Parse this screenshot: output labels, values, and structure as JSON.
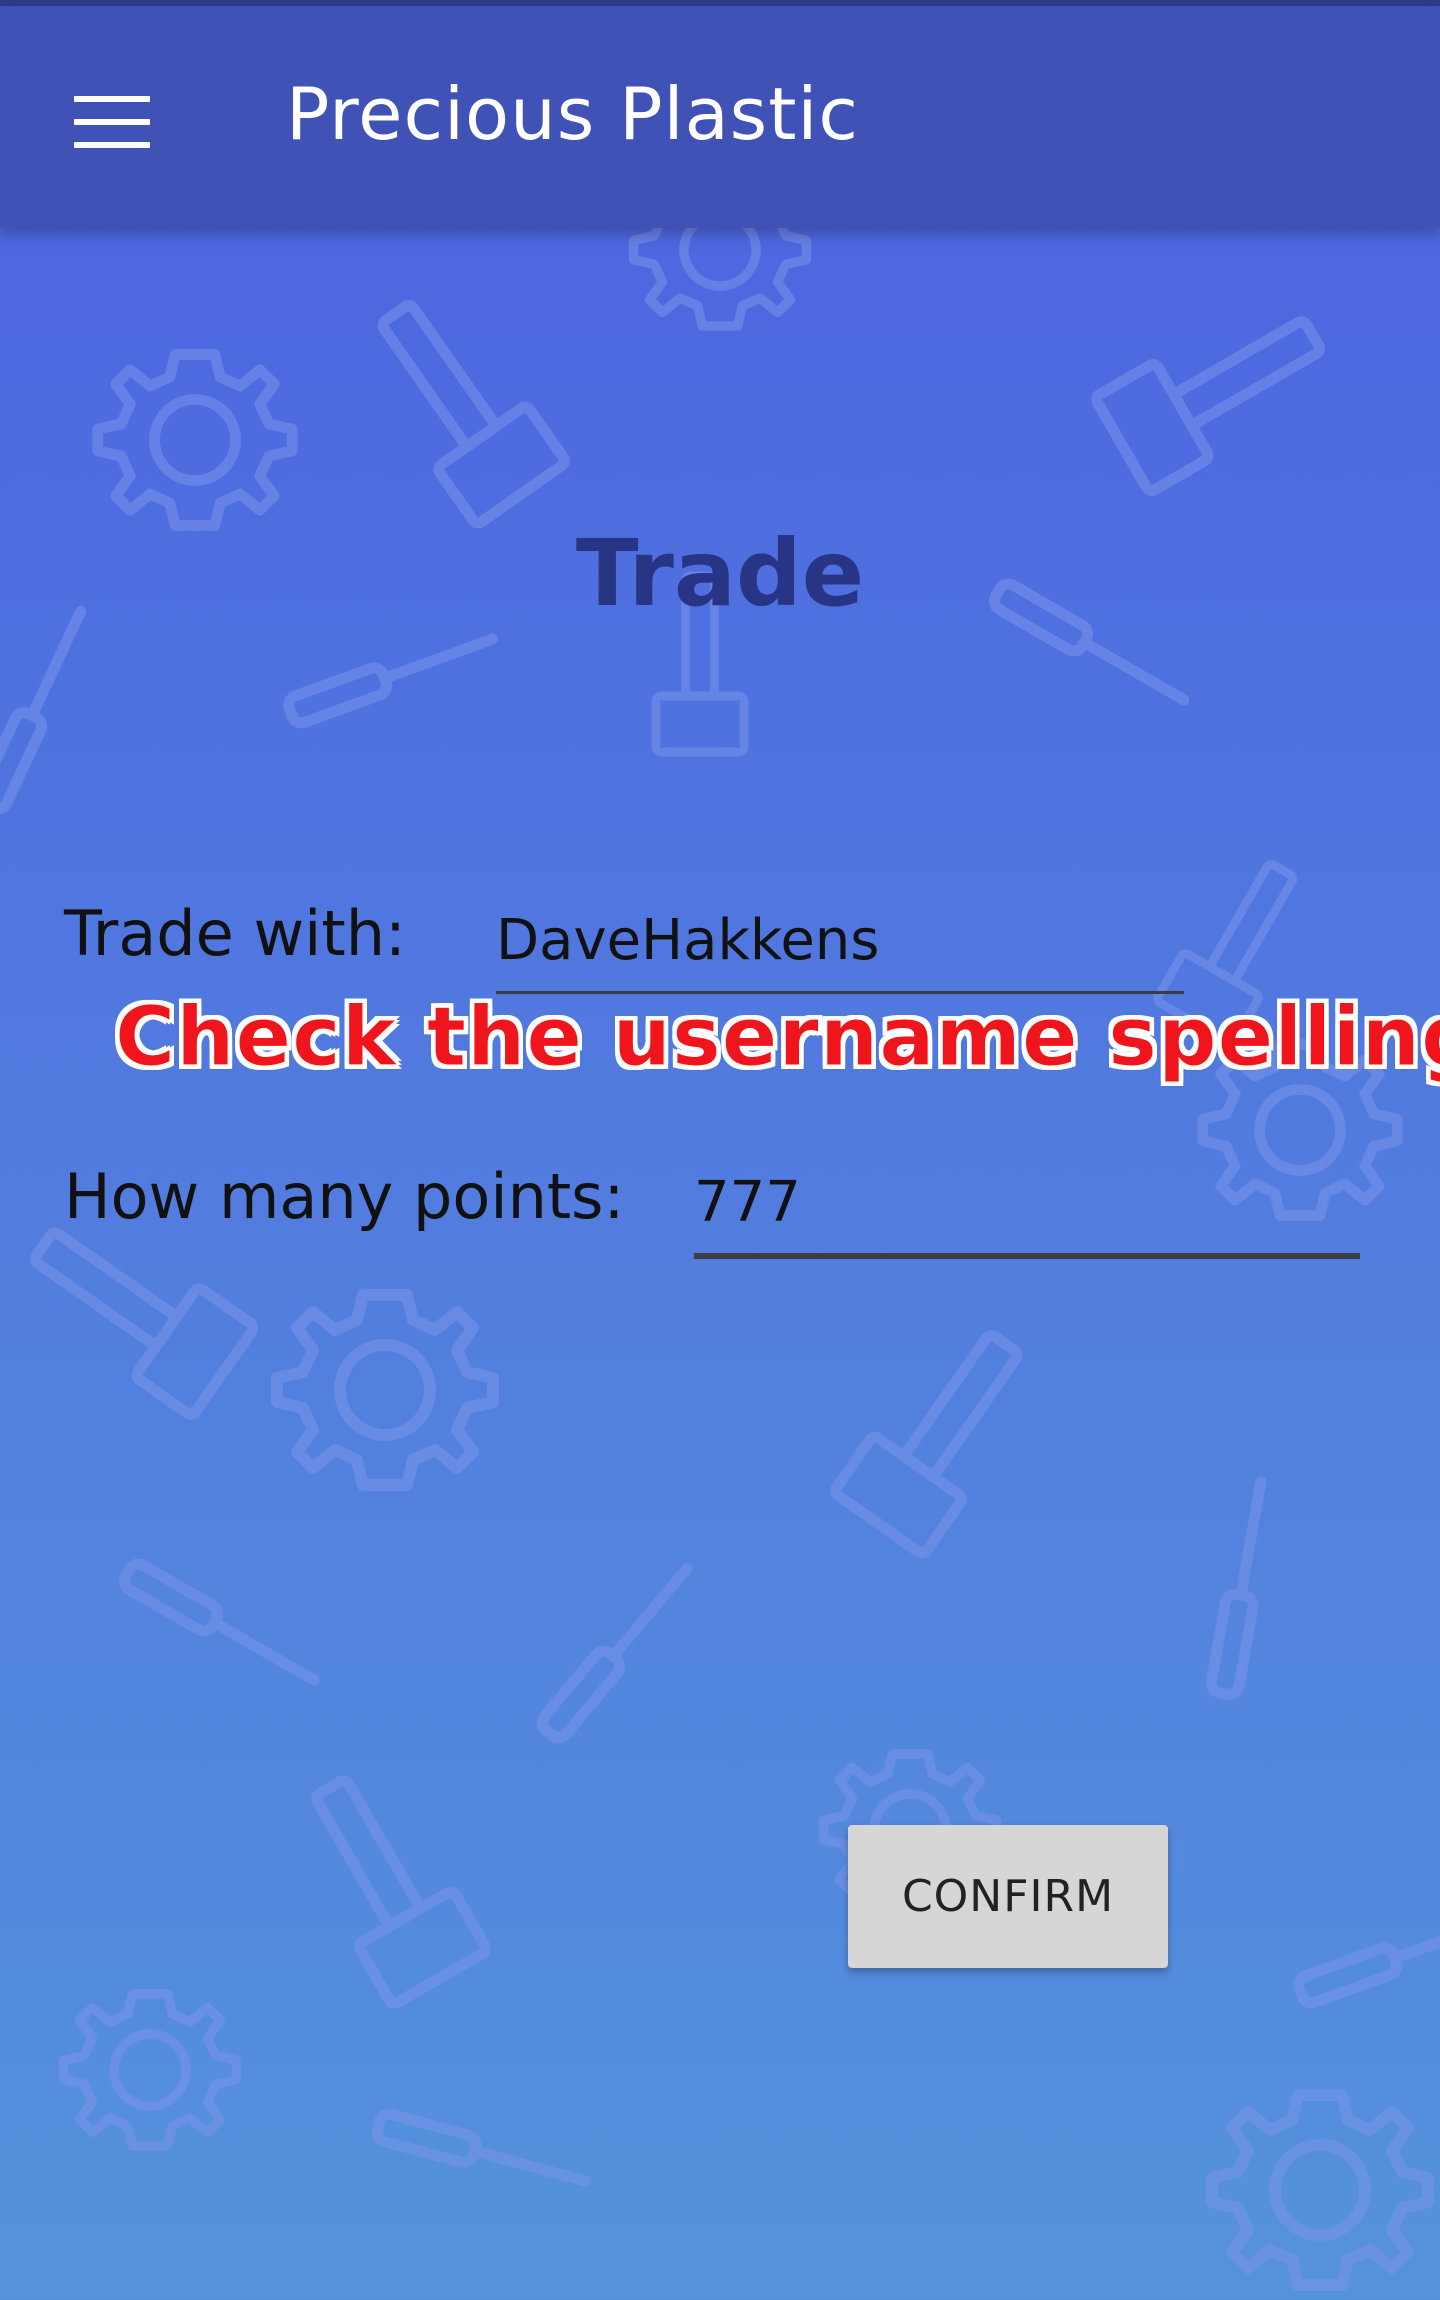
{
  "appbar": {
    "menu_icon": "hamburger-menu-icon",
    "title": "Precious Plastic"
  },
  "page": {
    "title": "Trade"
  },
  "form": {
    "trade_with_label": "Trade with:",
    "trade_with_value": "DaveHakkens",
    "warning": "Check the username spelling",
    "points_label": "How many points:",
    "points_value": "777",
    "confirm_label": "CONFIRM"
  },
  "colors": {
    "appbar": "#4052b5",
    "background_top": "#4c62e0",
    "background_bottom": "#5592dc",
    "title": "#283584",
    "warning": "#f0141c",
    "button": "#d6d6d6"
  }
}
